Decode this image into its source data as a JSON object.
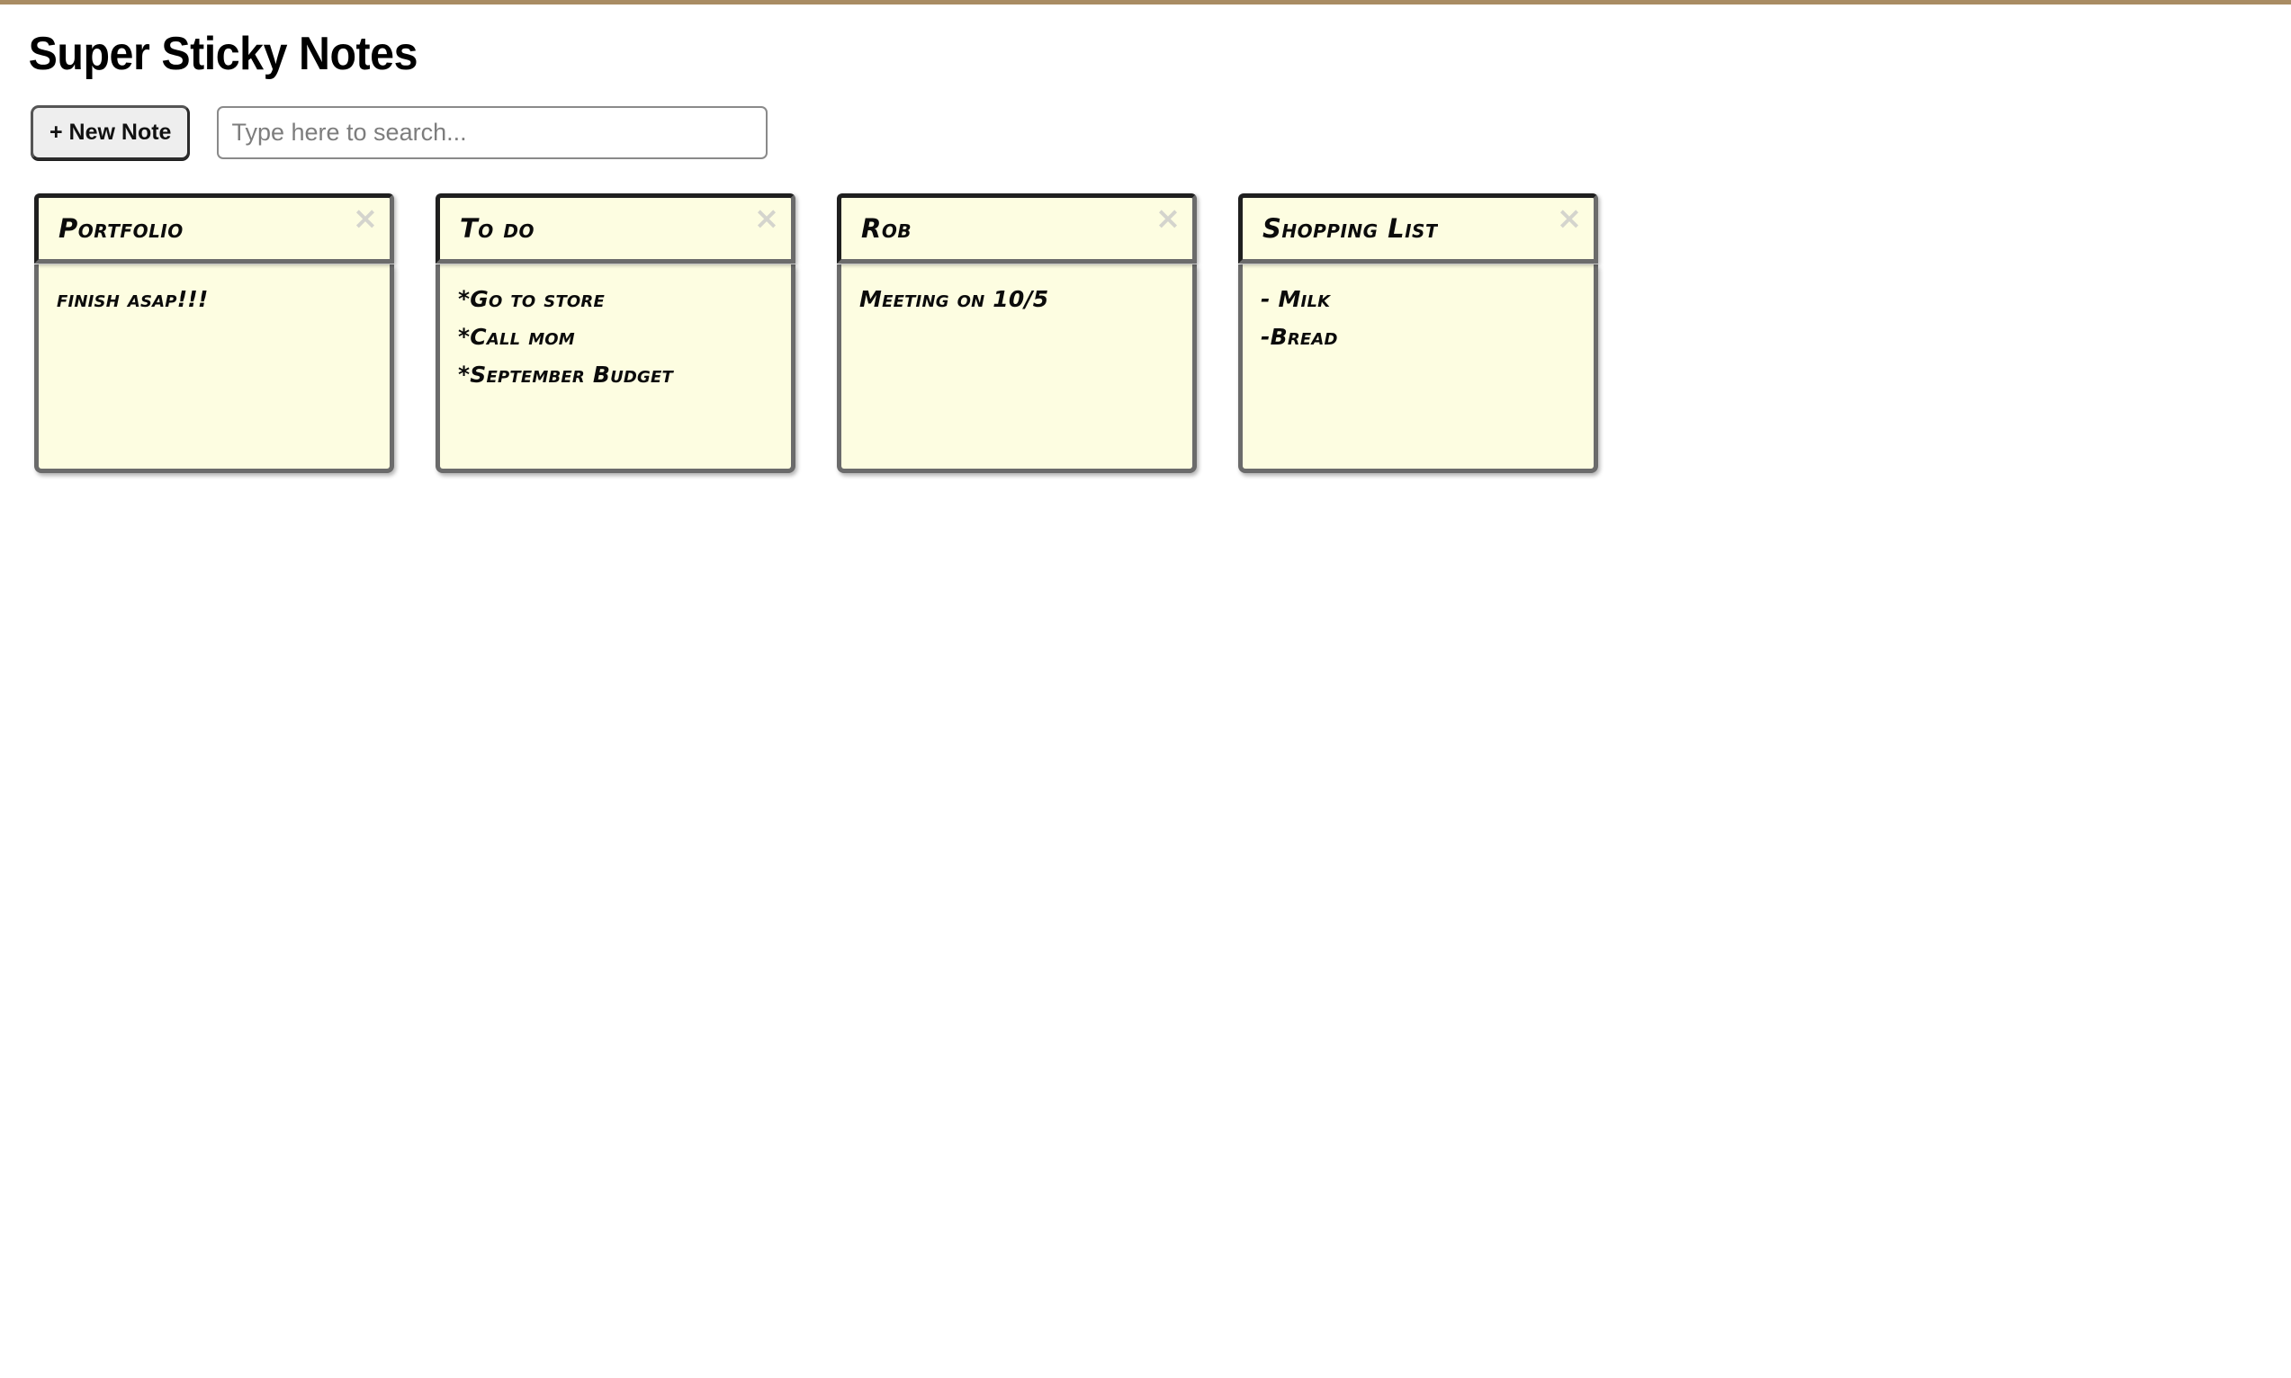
{
  "app": {
    "title": "Super Sticky Notes",
    "top_strip_color": "#a98c63",
    "note_color": "#fdfde1",
    "note_border_color": "#6b6b6b",
    "note_header_border_color": "#1f1f1f",
    "close_icon_color": "#d4d4cd"
  },
  "toolbar": {
    "new_note_label": "+ New Note",
    "search_value": "",
    "search_placeholder": "Type here to search..."
  },
  "notes": [
    {
      "title": "Portfolio",
      "close_icon": "×",
      "close_icon_name": "close-icon",
      "lines": [
        "finish asap!!!"
      ]
    },
    {
      "title": "To do",
      "close_icon": "×",
      "close_icon_name": "close-icon",
      "lines": [
        "*Go to store",
        "*Call mom",
        "*September Budget"
      ]
    },
    {
      "title": "Rob",
      "close_icon": "×",
      "close_icon_name": "close-icon",
      "lines": [
        "Meeting on 10/5"
      ]
    },
    {
      "title": "Shopping List",
      "close_icon": "×",
      "close_icon_name": "close-icon",
      "lines": [
        "- Milk",
        "-Bread"
      ]
    }
  ]
}
